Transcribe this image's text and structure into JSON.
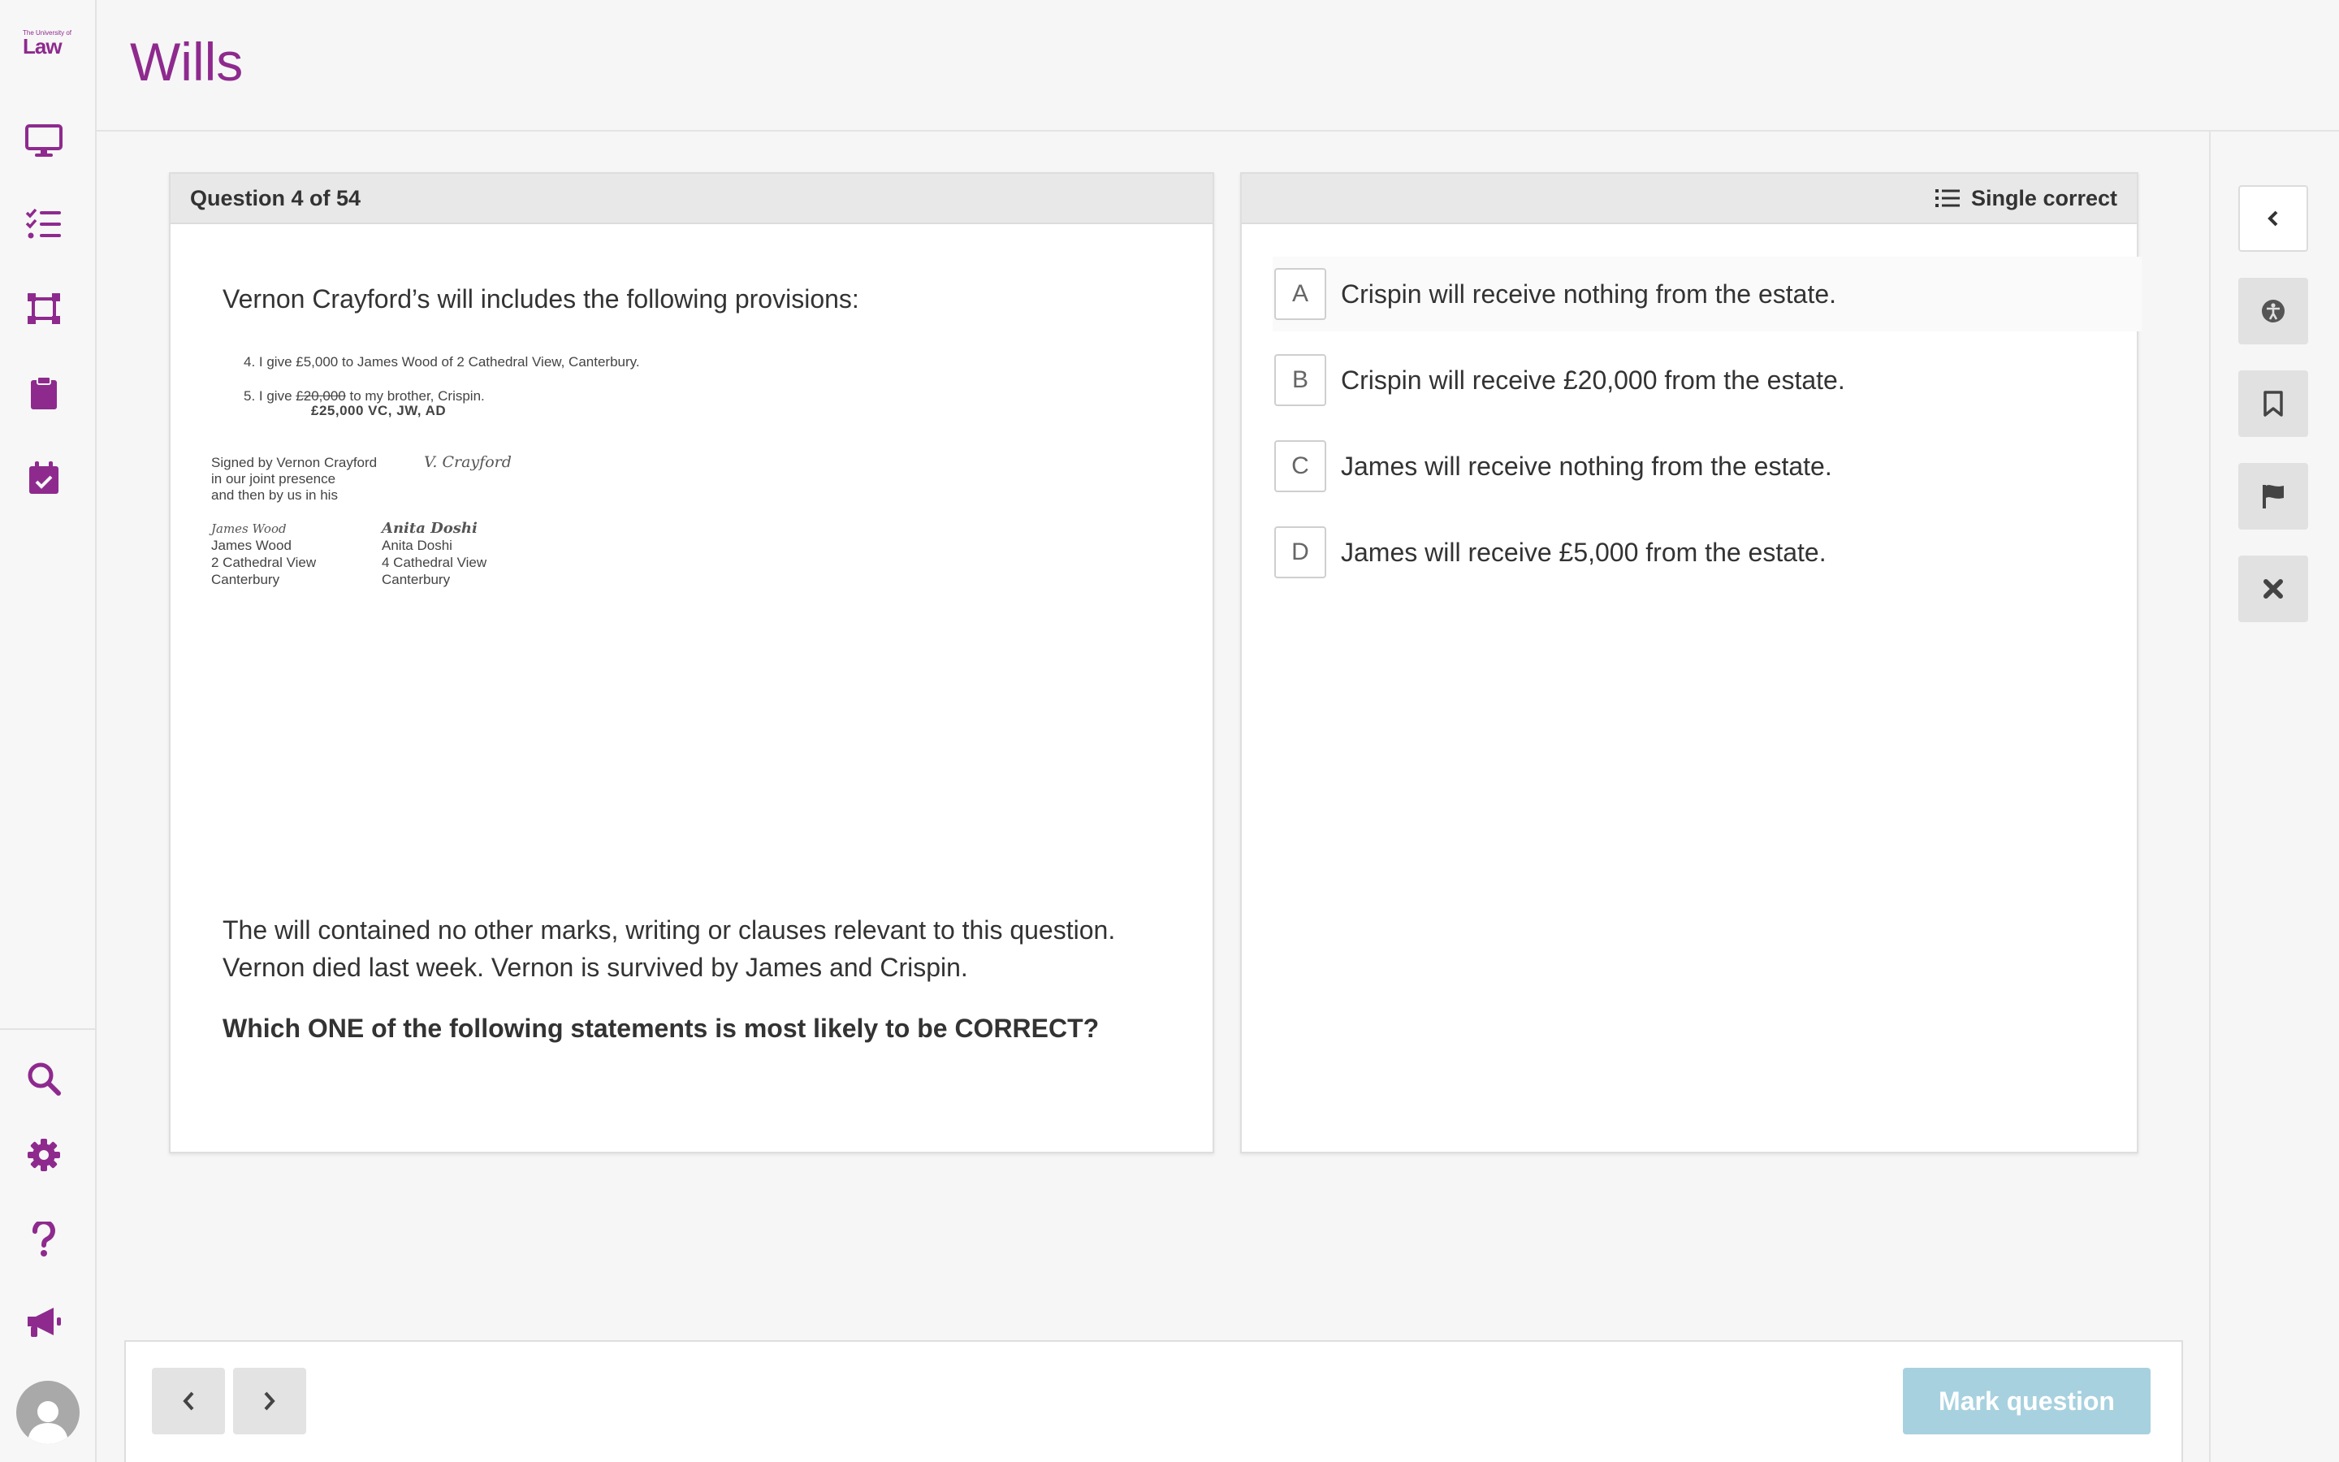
{
  "brand": {
    "logo_small": "The University of",
    "logo_big": "Law"
  },
  "header": {
    "title": "Wills"
  },
  "sidebar": {
    "top_icons": [
      "monitor-icon",
      "checklist-icon",
      "frame-icon",
      "clipboard-icon",
      "calendar-check-icon"
    ],
    "bottom_icons": [
      "search-icon",
      "gear-icon",
      "question-icon",
      "megaphone-icon"
    ],
    "accent": "#8e2a8e"
  },
  "question": {
    "counter": "Question 4 of 54",
    "intro": "Vernon Crayford’s will includes the following provisions:",
    "will": {
      "clause4": "4. I give £5,000 to James Wood of 2 Cathedral View, Canterbury.",
      "clause5_a": "5. I give",
      "clause5_struck": "£20,000",
      "clause5_b": "to my brother, Crispin.",
      "insertion": "£25,000  VC, JW, AD",
      "signed_l1": "Signed by Vernon Crayford",
      "signed_l2": "in our joint presence",
      "signed_l3": "and then by us in his",
      "testator_sig": "V. Crayford",
      "w1_sig": "James Wood",
      "w1_name": "James Wood",
      "w1_addr1": "2 Cathedral View",
      "w1_addr2": "Canterbury",
      "w2_sig": "Anita Doshi",
      "w2_name": "Anita Doshi",
      "w2_addr1": "4 Cathedral View",
      "w2_addr2": "Canterbury"
    },
    "outro_l1": "The will contained no other marks, writing or clauses relevant to this question.",
    "outro_l2": "Vernon died last week. Vernon is survived by James and Crispin.",
    "ask": "Which ONE of the following statements is most likely to be CORRECT?"
  },
  "answers": {
    "type_label": "Single correct",
    "options": [
      {
        "letter": "A",
        "text": "Crispin will receive nothing from the estate."
      },
      {
        "letter": "B",
        "text": "Crispin will receive £20,000 from the estate."
      },
      {
        "letter": "C",
        "text": "James will receive nothing from the estate."
      },
      {
        "letter": "D",
        "text": "James will receive £5,000 from the estate."
      }
    ]
  },
  "tools": [
    "chevron-left-icon",
    "accessibility-icon",
    "bookmark-icon",
    "flag-icon",
    "close-icon"
  ],
  "footer": {
    "mark_label": "Mark question",
    "mark_color": "#a7d1df"
  }
}
